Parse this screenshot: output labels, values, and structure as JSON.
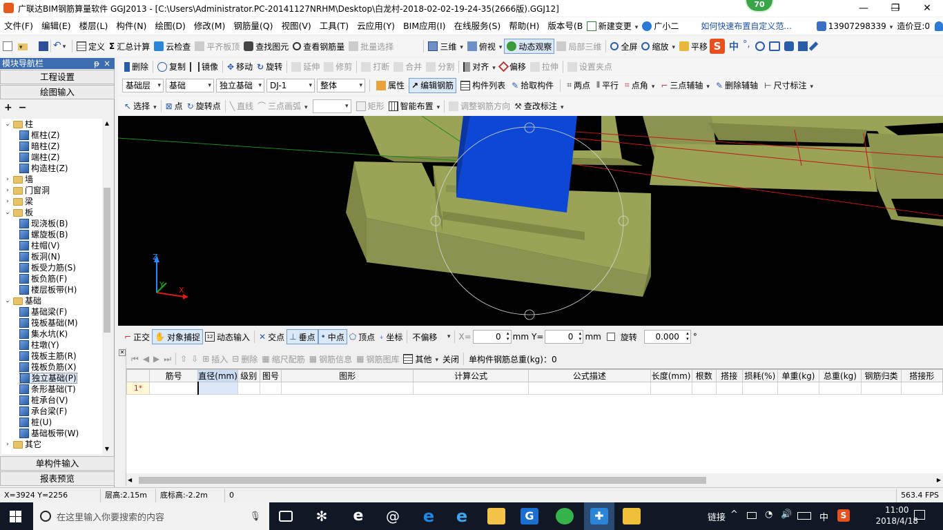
{
  "window": {
    "title": "广联达BIM钢筋算量软件 GGJ2013 - [C:\\Users\\Administrator.PC-20141127NRHM\\Desktop\\白龙村-2018-02-02-19-24-35(2666版).GGJ12]",
    "badge": "70",
    "minimize": "—",
    "restore": "❐",
    "close": "✕"
  },
  "menu": {
    "items": [
      "文件(F)",
      "编辑(E)",
      "楼层(L)",
      "构件(N)",
      "绘图(D)",
      "修改(M)",
      "钢筋量(Q)",
      "视图(V)",
      "工具(T)",
      "云应用(Y)",
      "BIM应用(I)",
      "在线服务(S)",
      "帮助(H)",
      "版本号(B)"
    ],
    "new_change": "新建变更",
    "guangxiaoer": "广小二",
    "help_link": "如何快速布置自定义范...",
    "phone": "13907298339",
    "price": "造价豆:0"
  },
  "toolbar1": {
    "define": "定义",
    "sum": "汇总计算",
    "cloud_check": "云检查",
    "align_top": "平齐板顶",
    "find": "查找图元",
    "view_rebar": "查看钢筋量",
    "batch_select": "批量选择",
    "view3d": "三维",
    "top_view": "俯视",
    "dynamic": "动态观察",
    "local3d": "局部三维",
    "fullscreen": "全屏",
    "zoom": "缩放",
    "pan": "平移",
    "ime_zh": "中"
  },
  "toolbar2": {
    "delete": "删除",
    "copy": "复制",
    "mirror": "镜像",
    "move": "移动",
    "rotate": "旋转",
    "extend": "延伸",
    "trim": "修剪",
    "break": "打断",
    "merge": "合并",
    "split": "分割",
    "align": "对齐",
    "offset": "偏移",
    "stretch": "拉伸",
    "set_grip": "设置夹点"
  },
  "toolbar3": {
    "layer": "基础层",
    "floor": "基础",
    "type": "独立基础",
    "element": "DJ-1",
    "part": "整体",
    "property": "属性",
    "edit_rebar": "编辑钢筋",
    "list": "构件列表",
    "pick": "拾取构件",
    "two_points": "两点",
    "parallel": "平行",
    "point_angle": "点角",
    "three_axis": "三点辅轴",
    "del_axis": "删除辅轴",
    "dimension": "尺寸标注"
  },
  "toolbar4": {
    "select": "选择",
    "point": "点",
    "rotate_point": "旋转点",
    "line": "直线",
    "arc": "三点画弧",
    "rect": "矩形",
    "smart": "智能布置",
    "adjust_dir": "调整钢筋方向",
    "modify_label": "查改标注"
  },
  "sidebar": {
    "title": "模块导航栏",
    "pin": "ᵽ",
    "close": "×",
    "eng_settings": "工程设置",
    "draw_input": "绘图输入",
    "expand": "+",
    "collapse": "−",
    "tree": [
      {
        "label": "柱",
        "kind": "folder",
        "open": true,
        "level": 0
      },
      {
        "label": "框柱(Z)",
        "kind": "leaf",
        "level": 1
      },
      {
        "label": "暗柱(Z)",
        "kind": "leaf",
        "level": 1
      },
      {
        "label": "端柱(Z)",
        "kind": "leaf",
        "level": 1
      },
      {
        "label": "构造柱(Z)",
        "kind": "leaf",
        "level": 1
      },
      {
        "label": "墙",
        "kind": "folder",
        "open": false,
        "level": 0
      },
      {
        "label": "门窗洞",
        "kind": "folder",
        "open": false,
        "level": 0
      },
      {
        "label": "梁",
        "kind": "folder",
        "open": false,
        "level": 0
      },
      {
        "label": "板",
        "kind": "folder",
        "open": true,
        "level": 0
      },
      {
        "label": "现浇板(B)",
        "kind": "leaf",
        "level": 1
      },
      {
        "label": "螺旋板(B)",
        "kind": "leaf",
        "level": 1
      },
      {
        "label": "柱帽(V)",
        "kind": "leaf",
        "level": 1
      },
      {
        "label": "板洞(N)",
        "kind": "leaf",
        "level": 1
      },
      {
        "label": "板受力筋(S)",
        "kind": "leaf",
        "level": 1
      },
      {
        "label": "板负筋(F)",
        "kind": "leaf",
        "level": 1
      },
      {
        "label": "楼层板带(H)",
        "kind": "leaf",
        "level": 1
      },
      {
        "label": "基础",
        "kind": "folder",
        "open": true,
        "level": 0
      },
      {
        "label": "基础梁(F)",
        "kind": "leaf",
        "level": 1
      },
      {
        "label": "筏板基础(M)",
        "kind": "leaf",
        "level": 1
      },
      {
        "label": "集水坑(K)",
        "kind": "leaf",
        "level": 1
      },
      {
        "label": "柱墩(Y)",
        "kind": "leaf",
        "level": 1
      },
      {
        "label": "筏板主筋(R)",
        "kind": "leaf",
        "level": 1
      },
      {
        "label": "筏板负筋(X)",
        "kind": "leaf",
        "level": 1
      },
      {
        "label": "独立基础(P)",
        "kind": "leaf",
        "level": 1,
        "selected": true
      },
      {
        "label": "条形基础(T)",
        "kind": "leaf",
        "level": 1
      },
      {
        "label": "桩承台(V)",
        "kind": "leaf",
        "level": 1
      },
      {
        "label": "承台梁(F)",
        "kind": "leaf",
        "level": 1
      },
      {
        "label": "桩(U)",
        "kind": "leaf",
        "level": 1
      },
      {
        "label": "基础板带(W)",
        "kind": "leaf",
        "level": 1
      },
      {
        "label": "其它",
        "kind": "folder",
        "open": false,
        "level": 0
      }
    ],
    "single_input": "单构件输入",
    "report": "报表预览"
  },
  "snapbar": {
    "ortho": "正交",
    "osnap": "对象捕捉",
    "dyn_input": "动态输入",
    "intersect": "交点",
    "perp": "垂点",
    "mid": "中点",
    "vertex": "顶点",
    "coord": "坐标",
    "offset_mode": "不偏移",
    "x_label": "X=",
    "x_val": "0",
    "y_label": "Y=",
    "y_val": "0",
    "unit": "mm",
    "rotate": "旋转",
    "rotate_val": "0.000",
    "deg": "°"
  },
  "rebar": {
    "insert": "插入",
    "delete": "删除",
    "scale": "缩尺配筋",
    "info": "钢筋信息",
    "library": "钢筋图库",
    "other": "其他",
    "close": "关闭",
    "total_label": "单构件钢筋总重(kg)：0",
    "columns": [
      "筋号",
      "直径(mm)",
      "级别",
      "图号",
      "图形",
      "计算公式",
      "公式描述",
      "长度(mm)",
      "根数",
      "搭接",
      "损耗(%)",
      "单重(kg)",
      "总重(kg)",
      "钢筋归类",
      "搭接形"
    ],
    "row_marker": "1*"
  },
  "status": {
    "coords": "X=3924 Y=2256",
    "floor_height": "层高:2.15m",
    "base_elev": "底标高:-2.2m",
    "value": "0",
    "fps": "563.4 FPS"
  },
  "taskbar": {
    "search_placeholder": "在这里输入你要搜索的内容",
    "link": "链接",
    "ime": "中",
    "time": "11:00",
    "date": "2018/4/18"
  },
  "axis": {
    "z": "Z",
    "y": "Y",
    "x": "X"
  },
  "colors": {
    "concrete": "#9aa356",
    "column": "#0d47d6",
    "canvas_bg": "#000000",
    "taskbar": "#101826",
    "accent": "#3c6db0"
  }
}
